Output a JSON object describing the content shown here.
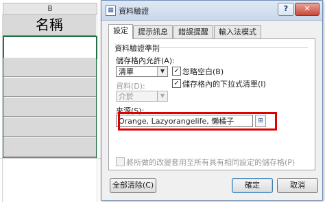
{
  "sheet": {
    "column_header": "B",
    "title_cell": "名稱"
  },
  "dialog": {
    "title": "資料驗證",
    "help_label": "?",
    "close_label": "✕",
    "tabs": [
      {
        "label": "設定"
      },
      {
        "label": "提示訊息"
      },
      {
        "label": "錯誤提醒"
      },
      {
        "label": "輸入法模式"
      }
    ],
    "criteria_group_label": "資料驗證準則",
    "allow_label": "儲存格內允許(A):",
    "allow_value": "清單",
    "ignore_blank_label": "忽略空白(B)",
    "ignore_blank_checked": true,
    "in_cell_dropdown_label": "儲存格內的下拉式清單(I)",
    "in_cell_dropdown_checked": true,
    "data_label": "資料(D):",
    "data_value": "介於",
    "source_label": "來源(S):",
    "source_value": "Orange, Lazyorangelife, 懶橘子",
    "apply_all_label": "將所做的改變套用至所有具有相同設定的儲存格(P)",
    "apply_all_checked": false,
    "clear_all_label": "全部清除(C)",
    "ok_label": "確定",
    "cancel_label": "取消"
  },
  "colors": {
    "highlight_border": "#e00000",
    "selection_border": "#217346"
  }
}
